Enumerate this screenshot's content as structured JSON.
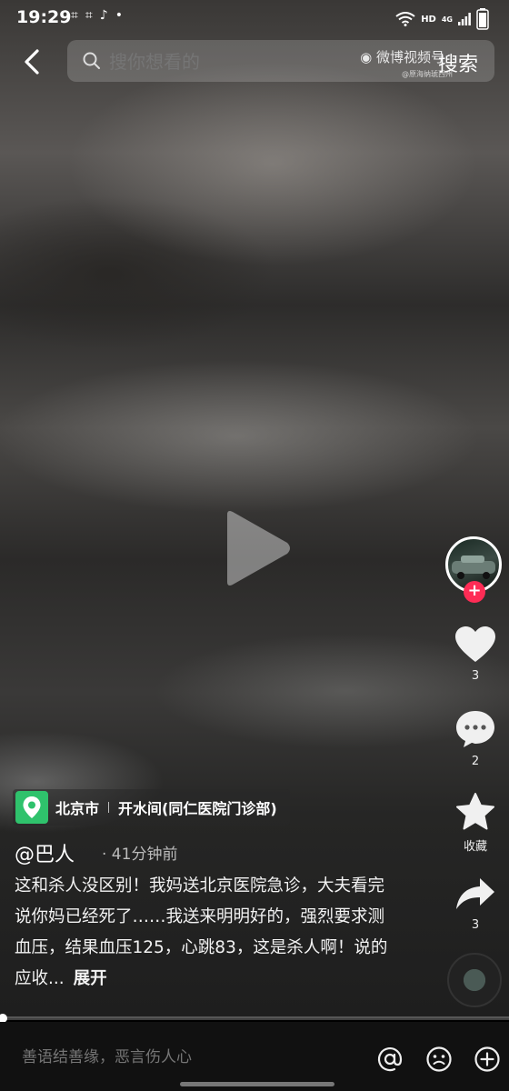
{
  "status": {
    "time": "19:29",
    "network": "HD",
    "signal_label": "4G"
  },
  "header": {
    "search_placeholder": "搜你想看的",
    "search_button": "搜索",
    "watermark": "微博视频号",
    "watermark_sub": "@原海纳琥西州"
  },
  "rail": {
    "like_count": "3",
    "comment_count": "2",
    "favorite_label": "收藏",
    "share_count": "3"
  },
  "post": {
    "location_city": "北京市",
    "location_place": "开水间(同仁医院门诊部)",
    "author": "@巴人",
    "time_ago": "· 41分钟前",
    "caption": "这和杀人没区别！我妈送北京医院急诊，大夫看完说你妈已经死了……我送来明明好的，强烈要求测血压，结果血压125，心跳83，这是杀人啊！说的应收...",
    "expand_label": "展开"
  },
  "bottom": {
    "comment_placeholder": "善语结善缘，恶言伤人心"
  },
  "colors": {
    "accent": "#fe2c55",
    "location_green": "#2fc26c"
  }
}
